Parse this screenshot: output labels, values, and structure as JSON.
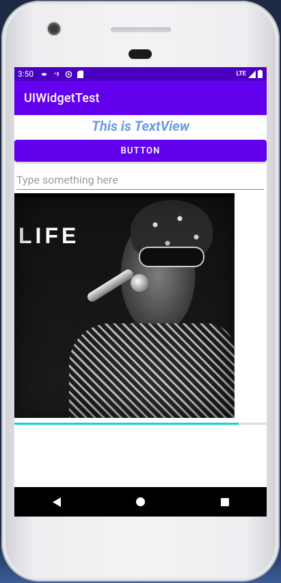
{
  "status_bar": {
    "time": "3:50",
    "network": "LTE",
    "icons_left": [
      "gear-icon",
      "sync-icon",
      "at-icon",
      "sd-card-icon"
    ],
    "icons_right": [
      "signal-icon",
      "battery-icon"
    ]
  },
  "app_bar": {
    "title": "UIWidgetTest"
  },
  "text_view": {
    "text": "This is TextView",
    "color": "#6a9be0"
  },
  "button": {
    "label": "BUTTON",
    "color": "#6200ee"
  },
  "edit_text": {
    "value": "",
    "placeholder": "Type something here"
  },
  "image": {
    "caption": "LIFE"
  },
  "progress": {
    "value": 0.89,
    "color": "#12d3c8"
  },
  "colors": {
    "status_bar": "#4a00bf",
    "primary": "#6200ee"
  },
  "nav_bar": {
    "buttons": [
      "back-icon",
      "home-icon",
      "recent-apps-icon"
    ]
  }
}
